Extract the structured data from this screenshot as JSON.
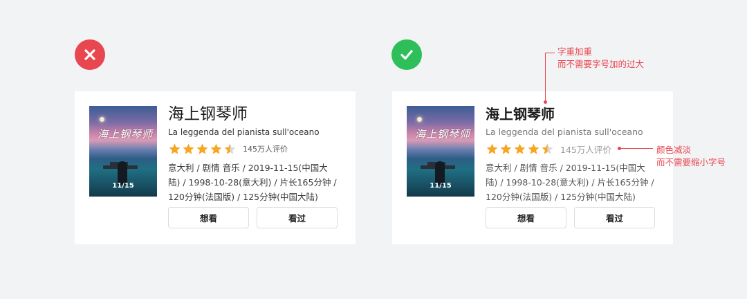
{
  "colors": {
    "bad": "#e8474f",
    "good": "#2fbf5a",
    "star": "#f5a623",
    "annotation": "#e8474f"
  },
  "marks": {
    "bad_icon": "close-icon",
    "good_icon": "check-icon"
  },
  "movie": {
    "title": "海上钢琴师",
    "subtitle": "La leggenda del pianista sull'oceano",
    "rating_stars": 4.5,
    "rating_count": "145万人评价",
    "description": "意大利 / 剧情 音乐 / 2019-11-15(中国大陆) / 1998-10-28(意大利) / 片长165分钟 / 120分钟(法国版) / 125分钟(中国大陆)",
    "poster_title": "海上钢琴师",
    "poster_date": "11/15"
  },
  "buttons": {
    "want": "想看",
    "seen": "看过"
  },
  "annotations": {
    "title_note_line1": "字重加重",
    "title_note_line2": "而不需要字号加的过大",
    "meta_note_line1": "颜色减淡",
    "meta_note_line2": "而不需要缩小字号"
  }
}
